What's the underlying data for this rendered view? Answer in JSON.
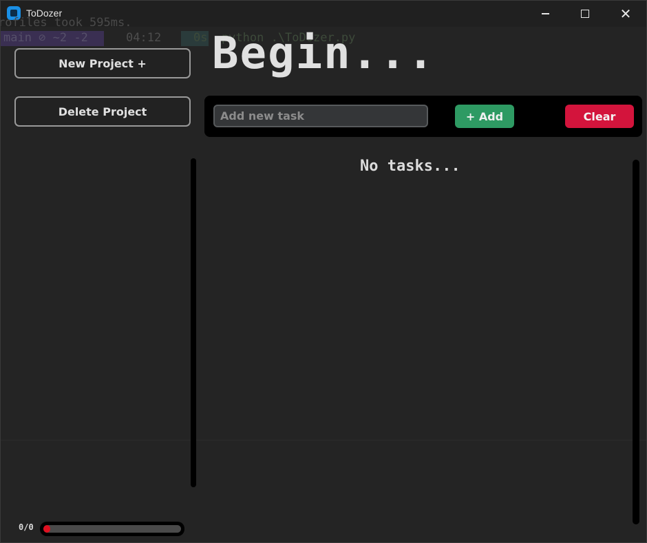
{
  "window": {
    "title": "ToDozer"
  },
  "ghost": {
    "line1": "rofiles took 595ms.",
    "branch": "main ⊘ ~2 -2",
    "time": "04:12",
    "command": "0s  python .\\ToDozer.py"
  },
  "sidebar": {
    "new_project_label": "New Project +",
    "delete_project_label": "Delete Project"
  },
  "main": {
    "heading": "Begin...",
    "task_input": {
      "value": "",
      "placeholder": "Add new task"
    },
    "add_label": "+ Add",
    "clear_label": "Clear",
    "empty_message": "No tasks..."
  },
  "progress": {
    "label": "0/0",
    "fraction": 0
  },
  "colors": {
    "add_button": "#2e9a63",
    "clear_button": "#d3143c",
    "progress_fill": "#e01020"
  }
}
